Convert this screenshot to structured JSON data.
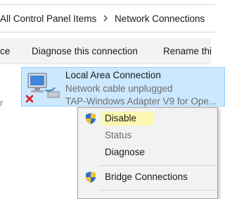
{
  "breadcrumb": {
    "items": [
      "All Control Panel Items",
      "Network Connections"
    ]
  },
  "commandbar": {
    "partial_left": "ce",
    "diagnose": "Diagnose this connection",
    "rename": "Rename thi"
  },
  "content": {
    "left_peek": "r"
  },
  "connection": {
    "name": "Local Area Connection",
    "status": "Network cable unplugged",
    "adapter": "TAP-Windows Adapter V9 for Ope..."
  },
  "context_menu": {
    "disable": "Disable",
    "status": "Status",
    "diagnose": "Diagnose",
    "bridge": "Bridge Connections"
  },
  "colors": {
    "selection_bg": "#cce8ff",
    "highlight_marker": "#fbf7b0",
    "disabled_text": "#6d6d6d"
  }
}
